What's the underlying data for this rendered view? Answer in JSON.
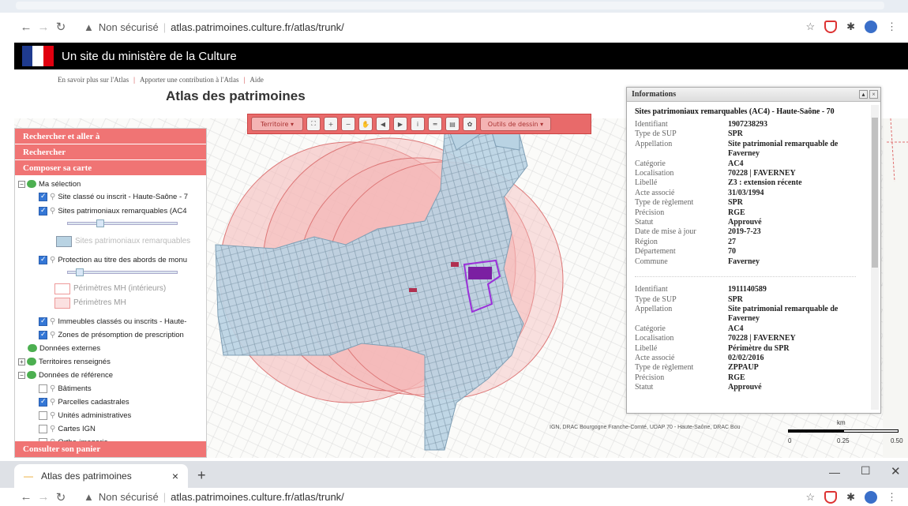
{
  "browser": {
    "security_label": "Non sécurisé",
    "url": "atlas.patrimoines.culture.fr/atlas/trunk/",
    "tab_title": "Atlas des patrimoines",
    "tab_close": "×",
    "new_tab": "+"
  },
  "ministry": {
    "text": "Un site du ministère de la Culture"
  },
  "sublinks": [
    "En savoir plus sur l'Atlas",
    "Apporter une contribution à l'Atlas",
    "Aide"
  ],
  "app": {
    "title": "Atlas des patrimoines"
  },
  "toolbar": {
    "territoire_label": "Territoire",
    "draw_label": "Outils de dessin"
  },
  "sidebar": {
    "sections": [
      "Rechercher et aller à",
      "Rechercher",
      "Composer sa carte"
    ],
    "footer": "Consulter son panier",
    "tree": {
      "ma_selection": "Ma sélection",
      "layer1": "Site classé ou inscrit - Haute-Saône - 7",
      "layer2": "Sites patrimoniaux remarquables (AC4",
      "legend2": "Sites patrimoniaux remarquables",
      "layer3": "Protection au titre des abords de monu",
      "legend3a": "Périmètres MH (intérieurs)",
      "legend3b": "Périmètres MH",
      "layer4": "Immeubles classés ou inscrits - Haute-",
      "layer5": "Zones de présomption de prescription",
      "donnees_externes": "Données externes",
      "territoires": "Territoires renseignés",
      "donnees_reference": "Données de référence",
      "ref1": "Bâtiments",
      "ref2": "Parcelles cadastrales",
      "ref3": "Unités administratives",
      "ref4": "Cartes IGN",
      "ref5": "Ortho-imagerie"
    }
  },
  "info": {
    "header": "Informations",
    "title": "Sites patrimoniaux remarquables (AC4) - Haute-Saône - 70",
    "records": [
      [
        [
          "Identifiant",
          "1907238293"
        ],
        [
          "Type de SUP",
          "SPR"
        ],
        [
          "Appellation",
          "Site patrimonial remarquable de Faverney"
        ],
        [
          "Catégorie",
          "AC4"
        ],
        [
          "Localisation",
          "70228 | FAVERNEY"
        ],
        [
          "Libellé",
          "Z3 : extension récente"
        ],
        [
          "Acte associé",
          "31/03/1994"
        ],
        [
          "Type de règlement",
          "SPR"
        ],
        [
          "Précision",
          "RGE"
        ],
        [
          "Statut",
          "Approuvé"
        ],
        [
          "Date de mise à jour",
          "2019-7-23"
        ],
        [
          "Région",
          "27"
        ],
        [
          "Département",
          "70"
        ],
        [
          "Commune",
          "Faverney"
        ]
      ],
      [
        [
          "Identifiant",
          "1911140589"
        ],
        [
          "Type de SUP",
          "SPR"
        ],
        [
          "Appellation",
          "Site patrimonial remarquable de Faverney"
        ],
        [
          "Catégorie",
          "AC4"
        ],
        [
          "Localisation",
          "70228 | FAVERNEY"
        ],
        [
          "Libellé",
          "Périmètre du SPR"
        ],
        [
          "Acte associé",
          "02/02/2016"
        ],
        [
          "Type de règlement",
          "ZPPAUP"
        ],
        [
          "Précision",
          "RGE"
        ],
        [
          "Statut",
          "Approuvé"
        ]
      ]
    ]
  },
  "map": {
    "attribution": "IGN, DRAC Bourgogne Franche-Comté, UDAP 70 - Haute-Saône, DRAC Bou",
    "scale_unit": "km",
    "scale_ticks": [
      "0",
      "0.25",
      "0.50"
    ]
  },
  "colors": {
    "accent": "#f07474",
    "spr_fill": "#b9d3e3",
    "mh_fill": "#f4b6b6"
  }
}
